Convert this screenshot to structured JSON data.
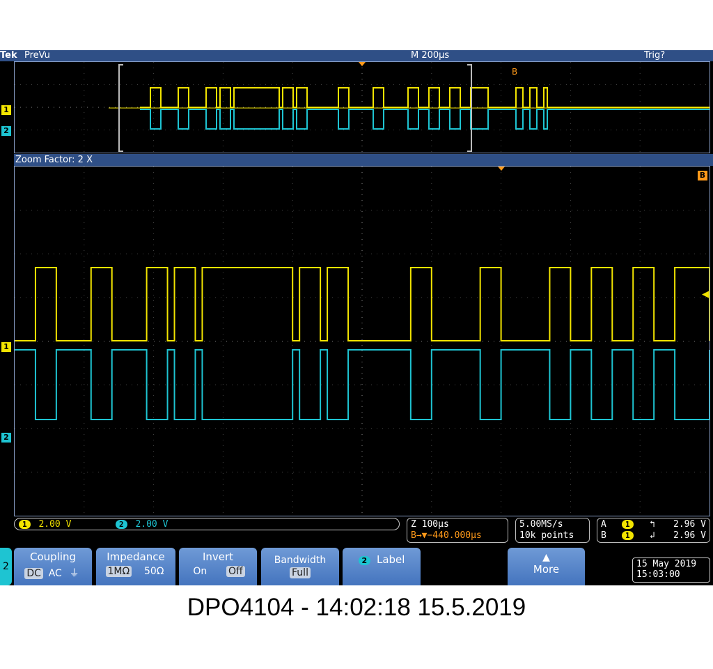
{
  "topbar": {
    "brand": "Tek",
    "mode": "PreVu",
    "timebase": "M 200µs",
    "trigger_state": "Trig?"
  },
  "zoom_label": "Zoom Factor: 2 X",
  "markers": {
    "ch1": "1",
    "ch2": "2",
    "b": "B"
  },
  "channels": {
    "ch1_num": "1",
    "ch1_scale": "2.00 V",
    "ch2_num": "2",
    "ch2_scale": "2.00 V"
  },
  "zoom_info": {
    "line1": "Z 100µs",
    "line2": "B→▼−440.000µs"
  },
  "acquisition": {
    "rate": "5.00MS/s",
    "points": "10k points"
  },
  "trigger": {
    "a_label": "A",
    "a_ch": "1",
    "a_level": "2.96 V",
    "b_label": "B",
    "b_ch": "1",
    "b_level": "2.96 V"
  },
  "menu": {
    "active_channel": "2",
    "coupling": {
      "title": "Coupling",
      "options": [
        "DC",
        "AC",
        "⏚"
      ],
      "selected": "DC"
    },
    "impedance": {
      "title": "Impedance",
      "options": [
        "1MΩ",
        "50Ω"
      ],
      "selected": "1MΩ"
    },
    "invert": {
      "title": "Invert",
      "options": [
        "On",
        "Off"
      ],
      "selected": "Off"
    },
    "bandwidth": {
      "title": "Bandwidth",
      "value": "Full"
    },
    "label": {
      "num": "2",
      "title": "Label"
    },
    "more": {
      "title": "More"
    }
  },
  "datetime": {
    "date": "15 May 2019",
    "time": "15:03:00"
  },
  "caption": "DPO4104 - 14:02:18   15.5.2019",
  "colors": {
    "ch1": "#f2e400",
    "ch2": "#1ec4d2",
    "bar": "#2f4f86",
    "trigger_marker": "#ff9a1a"
  },
  "signal": {
    "description_note": "Serial bursts; ch1 pulses high, ch2 mirrors low",
    "pulses_zoom_us": [
      [
        30,
        60
      ],
      [
        110,
        140
      ],
      [
        190,
        220
      ],
      [
        230,
        260
      ],
      [
        270,
        400
      ],
      [
        410,
        440
      ],
      [
        450,
        480
      ],
      [
        570,
        600
      ],
      [
        670,
        700
      ],
      [
        770,
        800
      ],
      [
        830,
        860
      ],
      [
        890,
        920
      ],
      [
        950,
        1000
      ]
    ]
  }
}
